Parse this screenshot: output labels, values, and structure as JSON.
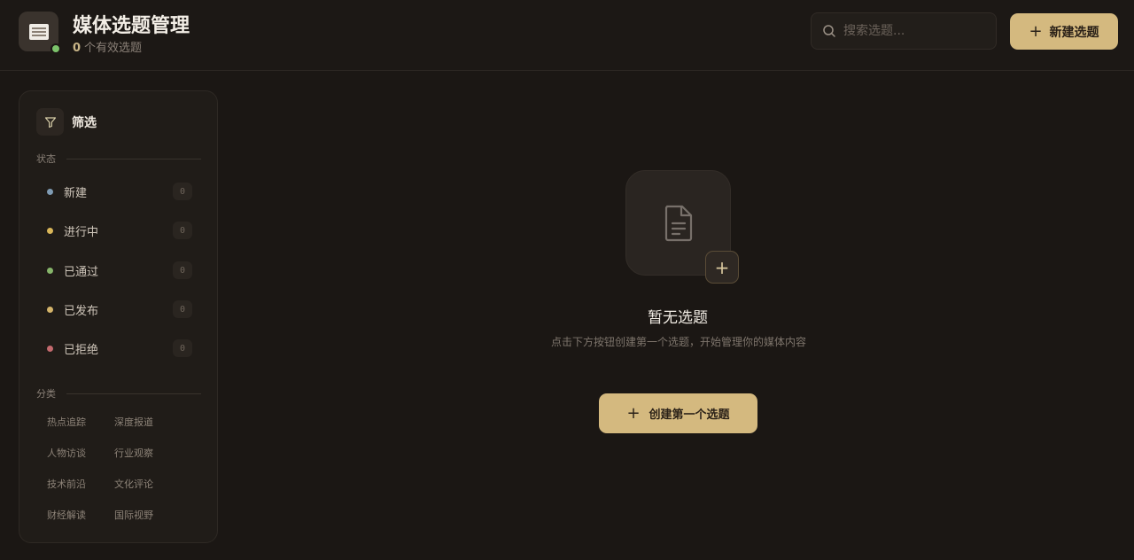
{
  "header": {
    "title": "媒体选题管理",
    "valid_count": "0",
    "valid_label": "个有效选题",
    "search_placeholder": "搜索选题...",
    "new_topic_label": "新建选题"
  },
  "sidebar": {
    "filter_title": "筛选",
    "status_section": "状态",
    "statuses": [
      {
        "label": "新建",
        "count": "0",
        "color": "#7f9bb3"
      },
      {
        "label": "进行中",
        "count": "0",
        "color": "#d9b659"
      },
      {
        "label": "已通过",
        "count": "0",
        "color": "#86b56a"
      },
      {
        "label": "已发布",
        "count": "0",
        "color": "#d4b46a"
      },
      {
        "label": "已拒绝",
        "count": "0",
        "color": "#c46a6e"
      }
    ],
    "category_section": "分类",
    "categories": [
      "热点追踪",
      "深度报道",
      "人物访谈",
      "行业观察",
      "技术前沿",
      "文化评论",
      "财经解读",
      "国际视野"
    ]
  },
  "empty_state": {
    "title": "暂无选题",
    "description": "点击下方按钮创建第一个选题，开始管理你的媒体内容",
    "button_label": "创建第一个选题"
  },
  "colors": {
    "accent": "#d4b97f",
    "background": "#1b1714"
  }
}
